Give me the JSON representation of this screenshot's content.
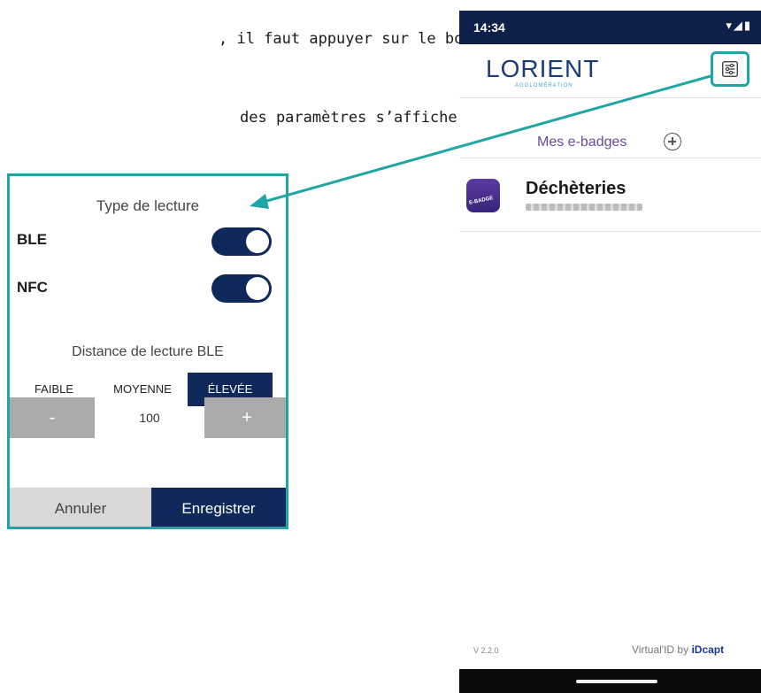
{
  "doc": {
    "line1": ", il faut appuyer sur le bouton",
    "line2": "des paramètres s’affiche."
  },
  "dialog": {
    "title": "Type de lecture",
    "ble_label": "BLE",
    "nfc_label": "NFC",
    "ble_enabled": true,
    "nfc_enabled": true,
    "distance_title": "Distance de lecture BLE",
    "distance_options": [
      "FAIBLE",
      "MOYENNE",
      "ÉLEVÉE"
    ],
    "distance_selected": "ÉLEVÉE",
    "stepper": {
      "minus": "-",
      "value": "100",
      "plus": "+"
    },
    "cancel_label": "Annuler",
    "save_label": "Enregistrer"
  },
  "phone": {
    "status_time": "14:34",
    "status_icons": "▾◢▮",
    "logo_text": "LORIENT",
    "logo_sub": "AGGLOMÉRATION",
    "tab_label": "Mes e-badges",
    "badge": {
      "title": "Déchèteries",
      "icon_text": "E-BADGE"
    },
    "version": "V 2.2.0",
    "brand_prefix": "Virtual'ID by ",
    "brand_name": "iDcapt"
  },
  "colors": {
    "accent_teal": "#1fa5a5",
    "navy": "#0f2a5a",
    "status_bar": "#0e1f49"
  }
}
